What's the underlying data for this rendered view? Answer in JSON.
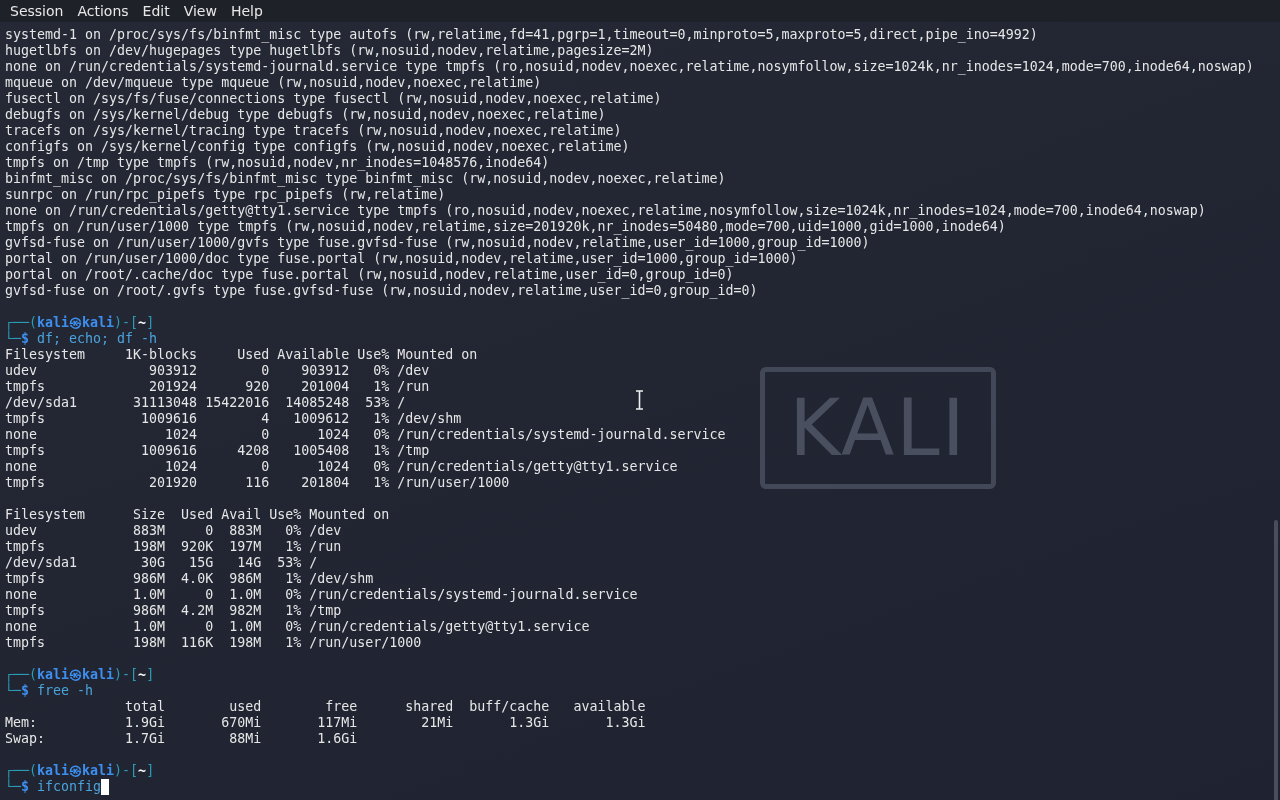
{
  "menu": [
    {
      "label": "Session"
    },
    {
      "label": "Actions"
    },
    {
      "label": "Edit"
    },
    {
      "label": "View"
    },
    {
      "label": "Help"
    }
  ],
  "wallpaper": {
    "logo": "KALI"
  },
  "terminal": {
    "lines": [
      {
        "kind": "output",
        "text": "systemd-1 on /proc/sys/fs/binfmt_misc type autofs (rw,relatime,fd=41,pgrp=1,timeout=0,minproto=5,maxproto=5,direct,pipe_ino=4992)"
      },
      {
        "kind": "output",
        "text": "hugetlbfs on /dev/hugepages type hugetlbfs (rw,nosuid,nodev,relatime,pagesize=2M)"
      },
      {
        "kind": "output",
        "text": "none on /run/credentials/systemd-journald.service type tmpfs (ro,nosuid,nodev,noexec,relatime,nosymfollow,size=1024k,nr_inodes=1024,mode=700,inode64,noswap)"
      },
      {
        "kind": "output",
        "text": "mqueue on /dev/mqueue type mqueue (rw,nosuid,nodev,noexec,relatime)"
      },
      {
        "kind": "output",
        "text": "fusectl on /sys/fs/fuse/connections type fusectl (rw,nosuid,nodev,noexec,relatime)"
      },
      {
        "kind": "output",
        "text": "debugfs on /sys/kernel/debug type debugfs (rw,nosuid,nodev,noexec,relatime)"
      },
      {
        "kind": "output",
        "text": "tracefs on /sys/kernel/tracing type tracefs (rw,nosuid,nodev,noexec,relatime)"
      },
      {
        "kind": "output",
        "text": "configfs on /sys/kernel/config type configfs (rw,nosuid,nodev,noexec,relatime)"
      },
      {
        "kind": "output",
        "text": "tmpfs on /tmp type tmpfs (rw,nosuid,nodev,nr_inodes=1048576,inode64)"
      },
      {
        "kind": "output",
        "text": "binfmt_misc on /proc/sys/fs/binfmt_misc type binfmt_misc (rw,nosuid,nodev,noexec,relatime)"
      },
      {
        "kind": "output",
        "text": "sunrpc on /run/rpc_pipefs type rpc_pipefs (rw,relatime)"
      },
      {
        "kind": "output",
        "text": "none on /run/credentials/getty@tty1.service type tmpfs (ro,nosuid,nodev,noexec,relatime,nosymfollow,size=1024k,nr_inodes=1024,mode=700,inode64,noswap)"
      },
      {
        "kind": "output",
        "text": "tmpfs on /run/user/1000 type tmpfs (rw,nosuid,nodev,relatime,size=201920k,nr_inodes=50480,mode=700,uid=1000,gid=1000,inode64)"
      },
      {
        "kind": "output",
        "text": "gvfsd-fuse on /run/user/1000/gvfs type fuse.gvfsd-fuse (rw,nosuid,nodev,relatime,user_id=1000,group_id=1000)"
      },
      {
        "kind": "output",
        "text": "portal on /run/user/1000/doc type fuse.portal (rw,nosuid,nodev,relatime,user_id=1000,group_id=1000)"
      },
      {
        "kind": "output",
        "text": "portal on /root/.cache/doc type fuse.portal (rw,nosuid,nodev,relatime,user_id=0,group_id=0)"
      },
      {
        "kind": "output",
        "text": "gvfsd-fuse on /root/.gvfs type fuse.gvfsd-fuse (rw,nosuid,nodev,relatime,user_id=0,group_id=0)"
      },
      {
        "kind": "blank"
      },
      {
        "kind": "prompt",
        "open": "┌──(",
        "user": "kali㉿kali",
        "middle": ")-[",
        "dir": "~",
        "close": "]"
      },
      {
        "kind": "command",
        "frame": "└─",
        "symbol": "$",
        "command": "df; echo; df -h",
        "cursor": false
      },
      {
        "kind": "output",
        "text": "Filesystem     1K-blocks     Used Available Use% Mounted on"
      },
      {
        "kind": "output",
        "text": "udev              903912        0    903912   0% /dev"
      },
      {
        "kind": "output",
        "text": "tmpfs             201924      920    201004   1% /run"
      },
      {
        "kind": "output",
        "text": "/dev/sda1       31113048 15422016  14085248  53% /"
      },
      {
        "kind": "output",
        "text": "tmpfs            1009616        4   1009612   1% /dev/shm"
      },
      {
        "kind": "output",
        "text": "none                1024        0      1024   0% /run/credentials/systemd-journald.service"
      },
      {
        "kind": "output",
        "text": "tmpfs            1009616     4208   1005408   1% /tmp"
      },
      {
        "kind": "output",
        "text": "none                1024        0      1024   0% /run/credentials/getty@tty1.service"
      },
      {
        "kind": "output",
        "text": "tmpfs             201920      116    201804   1% /run/user/1000"
      },
      {
        "kind": "blank"
      },
      {
        "kind": "output",
        "text": "Filesystem      Size  Used Avail Use% Mounted on"
      },
      {
        "kind": "output",
        "text": "udev            883M     0  883M   0% /dev"
      },
      {
        "kind": "output",
        "text": "tmpfs           198M  920K  197M   1% /run"
      },
      {
        "kind": "output",
        "text": "/dev/sda1        30G   15G   14G  53% /"
      },
      {
        "kind": "output",
        "text": "tmpfs           986M  4.0K  986M   1% /dev/shm"
      },
      {
        "kind": "output",
        "text": "none            1.0M     0  1.0M   0% /run/credentials/systemd-journald.service"
      },
      {
        "kind": "output",
        "text": "tmpfs           986M  4.2M  982M   1% /tmp"
      },
      {
        "kind": "output",
        "text": "none            1.0M     0  1.0M   0% /run/credentials/getty@tty1.service"
      },
      {
        "kind": "output",
        "text": "tmpfs           198M  116K  198M   1% /run/user/1000"
      },
      {
        "kind": "blank"
      },
      {
        "kind": "prompt",
        "open": "┌──(",
        "user": "kali㉿kali",
        "middle": ")-[",
        "dir": "~",
        "close": "]"
      },
      {
        "kind": "command",
        "frame": "└─",
        "symbol": "$",
        "command": "free -h",
        "cursor": false
      },
      {
        "kind": "output",
        "text": "               total        used        free      shared  buff/cache   available"
      },
      {
        "kind": "output",
        "text": "Mem:           1.9Gi       670Mi       117Mi        21Mi       1.3Gi       1.3Gi"
      },
      {
        "kind": "output",
        "text": "Swap:          1.7Gi        88Mi       1.6Gi"
      },
      {
        "kind": "blank"
      },
      {
        "kind": "prompt",
        "open": "┌──(",
        "user": "kali㉿kali",
        "middle": ")-[",
        "dir": "~",
        "close": "]"
      },
      {
        "kind": "command",
        "frame": "└─",
        "symbol": "$",
        "command": "ifconfig",
        "cursor": true
      }
    ]
  }
}
